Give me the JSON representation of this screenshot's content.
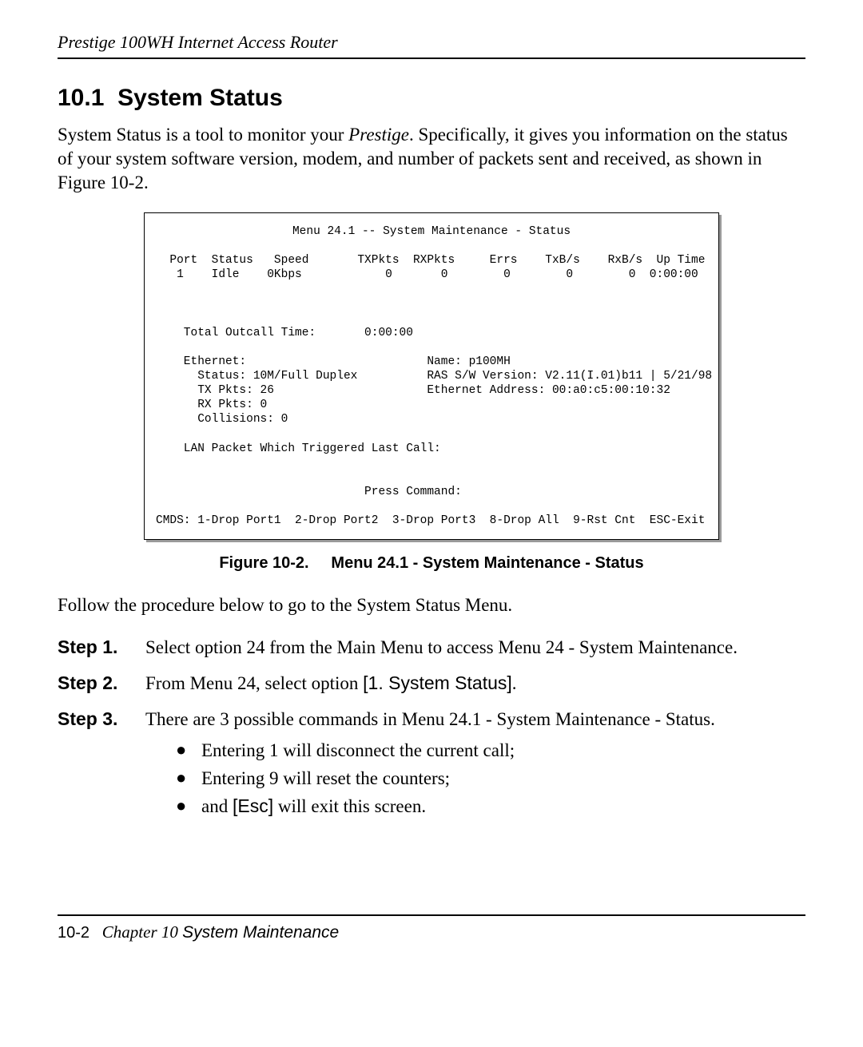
{
  "header": "Prestige 100WH Internet Access Router",
  "section_number": "10.1",
  "section_title": "System Status",
  "intro_before_italic": "System Status is a tool to monitor your ",
  "intro_italic": "Prestige",
  "intro_after_italic": ". Specifically, it gives you information on the status of your system software version, modem, and number of packets sent and received, as shown in Figure 10-2.",
  "terminal": {
    "title": "Menu 24.1 -- System Maintenance - Status",
    "cols": "  Port  Status   Speed       TXPkts  RXPkts     Errs    TxB/s    RxB/s  Up Time",
    "row": "   1    Idle    0Kbps            0       0        0        0        0  0:00:00",
    "outcall_line": "    Total Outcall Time:       0:00:00",
    "eth_header": "    Ethernet:                          Name: p100MH",
    "eth_status": "      Status: 10M/Full Duplex          RAS S/W Version: V2.11(I.01)b11 | 5/21/98",
    "eth_tx": "      TX Pkts: 26                      Ethernet Address: 00:a0:c5:00:10:32",
    "eth_rx": "      RX Pkts: 0",
    "eth_coll": "      Collisions: 0",
    "lan_packet": "    LAN Packet Which Triggered Last Call:",
    "press_cmd": "                              Press Command:",
    "cmds": "CMDS: 1-Drop Port1  2-Drop Port2  3-Drop Port3  8-Drop All  9-Rst Cnt  ESC-Exit"
  },
  "figure_label": "Figure 10-2.",
  "figure_title": "Menu 24.1 - System Maintenance - Status",
  "follow_text": "Follow the procedure below to go to the System Status Menu.",
  "steps": [
    {
      "label": "Step 1.",
      "body_plain": "Select option 24 from the Main Menu to access Menu 24 - System Maintenance."
    },
    {
      "label": "Step 2.",
      "body_before": "From Menu 24, select option ",
      "body_sans": "[1. System Status]",
      "body_after": "."
    },
    {
      "label": "Step 3.",
      "body_plain": "There are 3 possible commands in Menu 24.1 - System Maintenance - Status.",
      "bullets": [
        {
          "text": "Entering 1 will disconnect the current call;"
        },
        {
          "text": "Entering 9 will reset the counters;"
        },
        {
          "before": "and ",
          "sans": "[Esc]",
          "after": " will exit this screen."
        }
      ]
    }
  ],
  "footer": {
    "page_num": "10-2",
    "chapter_label": "Chapter 10",
    "chapter_title": "System Maintenance"
  }
}
